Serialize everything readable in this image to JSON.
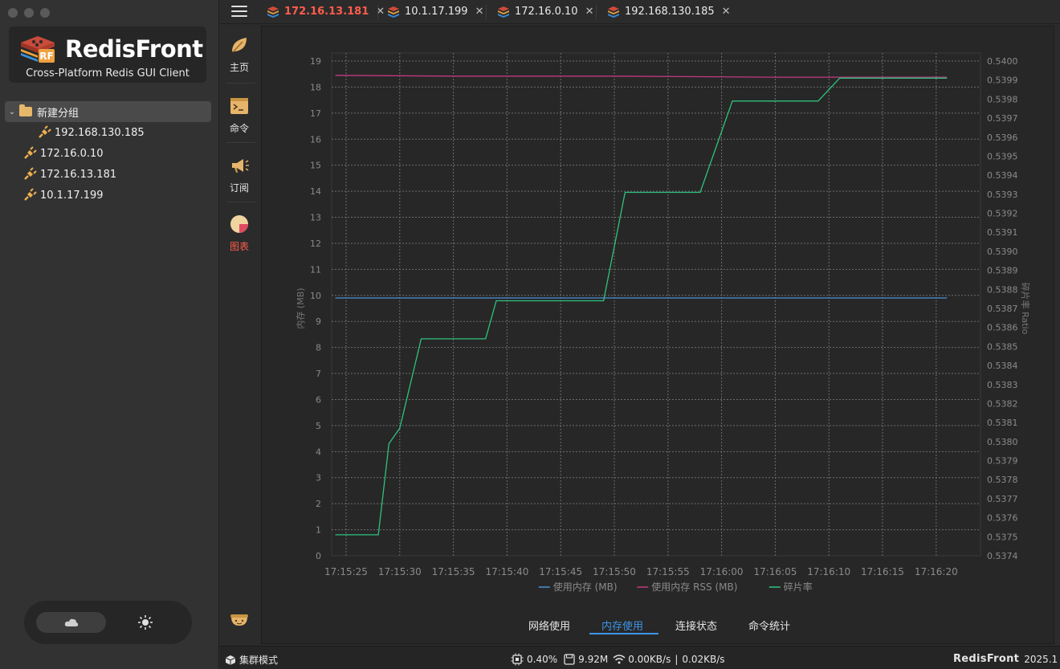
{
  "app": {
    "name": "RedisFront",
    "subtitle": "Cross-Platform Redis GUI Client"
  },
  "sidebar": {
    "group": {
      "label": "新建分组",
      "expanded": true
    },
    "group_children": [
      {
        "label": "192.168.130.185"
      }
    ],
    "connections": [
      {
        "label": "172.16.0.10"
      },
      {
        "label": "172.16.13.181"
      },
      {
        "label": "10.1.17.199"
      }
    ]
  },
  "iconbar": {
    "items": [
      {
        "label": "主页",
        "icon": "leaf-icon"
      },
      {
        "label": "命令",
        "icon": "terminal-icon"
      },
      {
        "label": "订阅",
        "icon": "megaphone-icon"
      },
      {
        "label": "图表",
        "icon": "pie-chart-icon",
        "active": true
      }
    ]
  },
  "tabs": [
    {
      "label": "172.16.13.181",
      "active": true
    },
    {
      "label": "10.1.17.199"
    },
    {
      "label": "172.16.0.10"
    },
    {
      "label": "192.168.130.185"
    }
  ],
  "subtabs": [
    {
      "label": "网络使用"
    },
    {
      "label": "内存使用",
      "active": true
    },
    {
      "label": "连接状态"
    },
    {
      "label": "命令统计"
    }
  ],
  "status": {
    "mode": "集群模式",
    "cpu": "0.40%",
    "memory": "9.92M",
    "net_in": "0.00KB/s",
    "divider": "|",
    "net_out": "0.02KB/s",
    "brand": "RedisFront",
    "version": "2025.1"
  },
  "colors": {
    "accent": "#3d95e8",
    "active_tab": "#ff5c4d",
    "series_used": "#4a90d9",
    "series_rss": "#c0397f",
    "series_frag": "#2ec27e"
  },
  "chart_data": {
    "type": "line",
    "x": [
      "17:15:25",
      "17:15:30",
      "17:15:35",
      "17:15:40",
      "17:15:45",
      "17:15:50",
      "17:15:55",
      "17:16:00",
      "17:16:05",
      "17:16:10",
      "17:16:15",
      "17:16:20"
    ],
    "ylabel": "内存 (MB)",
    "y2label": "碎片率 Ratio",
    "ylim": [
      0,
      19
    ],
    "y2lim": [
      0.5374,
      0.54
    ],
    "yticks": [
      "0",
      "1",
      "2",
      "3",
      "4",
      "5",
      "6",
      "7",
      "8",
      "9",
      "10",
      "11",
      "12",
      "13",
      "14",
      "15",
      "16",
      "17",
      "18",
      "19"
    ],
    "y2ticks": [
      "0.5374",
      "0.5375",
      "0.5376",
      "0.5377",
      "0.5378",
      "0.5379",
      "0.5380",
      "0.5381",
      "0.5382",
      "0.5383",
      "0.5384",
      "0.5385",
      "0.5386",
      "0.5387",
      "0.5388",
      "0.5389",
      "0.5390",
      "0.5391",
      "0.5392",
      "0.5393",
      "0.5394",
      "0.5395",
      "0.5396",
      "0.5397",
      "0.5398",
      "0.5399",
      "0.5400"
    ],
    "grid": true,
    "legend": "bottom",
    "series": [
      {
        "name": "使用内存 (MB)",
        "axis": "left",
        "points": [
          [
            "17:15:24",
            9.9
          ],
          [
            "17:16:21",
            9.9
          ]
        ]
      },
      {
        "name": "使用内存 RSS (MB)",
        "axis": "left",
        "points": [
          [
            "17:15:24",
            18.45
          ],
          [
            "17:15:35",
            18.42
          ],
          [
            "17:15:50",
            18.42
          ],
          [
            "17:16:05",
            18.38
          ],
          [
            "17:16:21",
            18.38
          ]
        ]
      },
      {
        "name": "碎片率",
        "axis": "right",
        "points": [
          [
            "17:15:24",
            0.53751
          ],
          [
            "17:15:28",
            0.53751
          ],
          [
            "17:15:29",
            0.53799
          ],
          [
            "17:15:30",
            0.53807
          ],
          [
            "17:15:32",
            0.53854
          ],
          [
            "17:15:38",
            0.53854
          ],
          [
            "17:15:39",
            0.53874
          ],
          [
            "17:15:49",
            0.53874
          ],
          [
            "17:15:51",
            0.53931
          ],
          [
            "17:15:58",
            0.53931
          ],
          [
            "17:16:01",
            0.53979
          ],
          [
            "17:16:09",
            0.53979
          ],
          [
            "17:16:11",
            0.53991
          ],
          [
            "17:16:21",
            0.53991
          ]
        ]
      }
    ]
  }
}
